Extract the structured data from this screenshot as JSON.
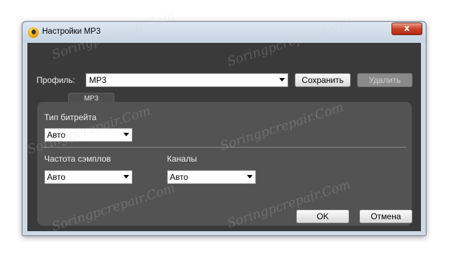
{
  "window": {
    "title": "Настройки MP3",
    "close_label": "x"
  },
  "profile": {
    "label": "Профиль:",
    "value": "MP3",
    "save_label": "Сохранить",
    "delete_label": "Удалить"
  },
  "tab": {
    "label": "MP3"
  },
  "bitrate": {
    "label": "Тип битрейта",
    "value": "Авто"
  },
  "sample_rate": {
    "label": "Частота сэмплов",
    "value": "Авто"
  },
  "channels": {
    "label": "Каналы",
    "value": "Авто"
  },
  "footer": {
    "ok_label": "OK",
    "cancel_label": "Отмена"
  },
  "watermark_text": "Soringpcrepair.Com"
}
